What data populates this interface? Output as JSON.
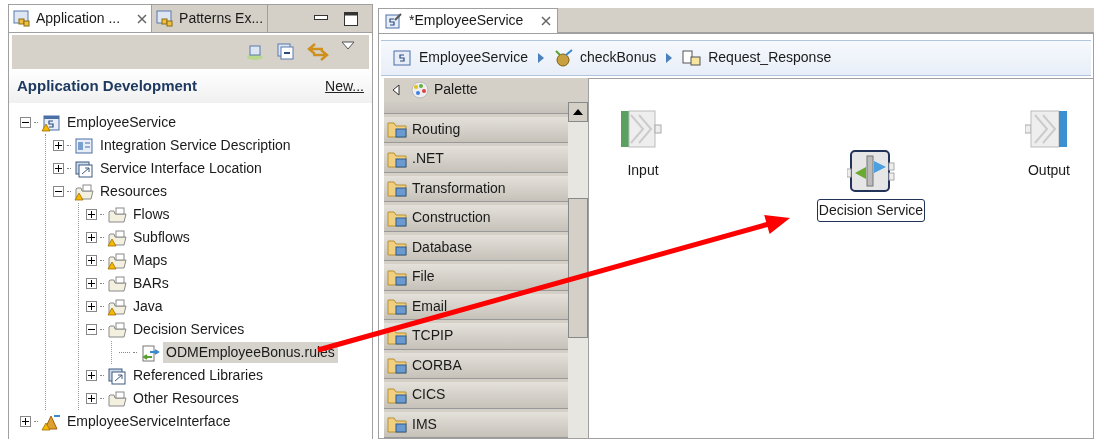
{
  "left_panel": {
    "tabs": [
      {
        "label": "Application ...",
        "selected": true,
        "closable": true
      },
      {
        "label": "Patterns Ex...",
        "selected": false,
        "closable": false
      }
    ],
    "header": {
      "title": "Application Development",
      "link": "New..."
    },
    "tree": [
      {
        "label": "EmployeeService",
        "kind": "service",
        "expanded": true,
        "warning": true,
        "selected": false,
        "children": [
          {
            "label": "Integration Service Description",
            "kind": "description",
            "expanded": false,
            "warning": false,
            "selected": false
          },
          {
            "label": "Service Interface Location",
            "kind": "reference",
            "expanded": false,
            "warning": false,
            "selected": false
          },
          {
            "label": "Resources",
            "kind": "folder",
            "expanded": true,
            "warning": true,
            "selected": false,
            "children": [
              {
                "label": "Flows",
                "kind": "folder",
                "expanded": false,
                "warning": false,
                "selected": false
              },
              {
                "label": "Subflows",
                "kind": "folder",
                "expanded": false,
                "warning": true,
                "selected": false
              },
              {
                "label": "Maps",
                "kind": "folder",
                "expanded": false,
                "warning": true,
                "selected": false
              },
              {
                "label": "BARs",
                "kind": "folder",
                "expanded": false,
                "warning": false,
                "selected": false
              },
              {
                "label": "Java",
                "kind": "folder",
                "expanded": false,
                "warning": true,
                "selected": false
              },
              {
                "label": "Decision Services",
                "kind": "folder",
                "expanded": true,
                "warning": false,
                "selected": false,
                "children": [
                  {
                    "label": "ODMEmployeeBonus.rules",
                    "kind": "rules",
                    "warning": false,
                    "selected": true
                  }
                ]
              },
              {
                "label": "Referenced Libraries",
                "kind": "reference",
                "expanded": false,
                "warning": false,
                "selected": false
              },
              {
                "label": "Other Resources",
                "kind": "folder",
                "expanded": false,
                "warning": false,
                "selected": false
              }
            ]
          }
        ]
      },
      {
        "label": "EmployeeServiceInterface",
        "kind": "interface",
        "expanded": false,
        "warning": true,
        "selected": false
      }
    ]
  },
  "editor": {
    "tab": {
      "label": "*EmployeeService",
      "selected": true
    },
    "breadcrumb": [
      {
        "label": "EmployeeService",
        "kind": "service"
      },
      {
        "label": "checkBonus",
        "kind": "operation"
      },
      {
        "label": "Request_Response",
        "kind": "flow"
      }
    ],
    "palette": {
      "title": "Palette",
      "drawers": [
        "Routing",
        ".NET",
        "Transformation",
        "Construction",
        "Database",
        "File",
        "Email",
        "TCPIP",
        "CORBA",
        "CICS",
        "IMS"
      ]
    },
    "nodes": [
      {
        "label": "Input",
        "kind": "input",
        "selected": false
      },
      {
        "label": "Decision Service",
        "kind": "decision",
        "selected": true
      },
      {
        "label": "Output",
        "kind": "output",
        "selected": false
      }
    ]
  }
}
